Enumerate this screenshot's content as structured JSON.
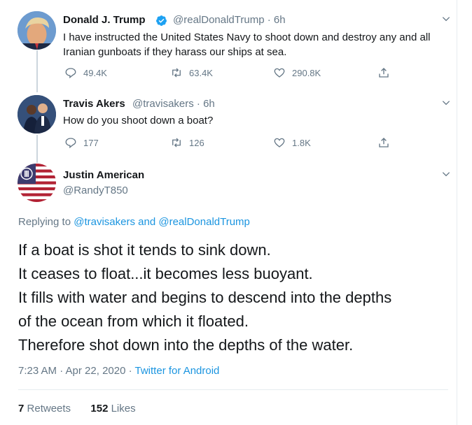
{
  "thread": [
    {
      "author_name": "Donald J. Trump",
      "handle": "@realDonaldTrump",
      "time": "· 6h",
      "text": "I have instructed the United States Navy to shoot down and destroy any and all Iranian gunboats if they harass our ships at sea.",
      "replies": "49.4K",
      "retweets": "63.4K",
      "likes": "290.8K",
      "verified": true
    },
    {
      "author_name": "Travis Akers",
      "handle": "@travisakers",
      "time": "· 6h",
      "text": "How do you shoot down a boat?",
      "replies": "177",
      "retweets": "126",
      "likes": "1.8K"
    }
  ],
  "main_tweet": {
    "author_name": "Justin American",
    "handle": "@RandyT850",
    "replying_prefix": "Replying to",
    "replying_user_1": "@travisakers",
    "replying_and": "and",
    "replying_user_2": "@realDonaldTrump",
    "lines": [
      "If a boat is shot it tends to sink down.",
      "It ceases to float...it becomes less buoyant.",
      "It fills with water and begins to descend into the depths",
      "of the ocean from which it floated.",
      "Therefore shot down into the depths of the water."
    ],
    "time": "7:23 AM · Apr 22, 2020 ·",
    "source": "Twitter for Android",
    "retweets_count": "7",
    "retweets_label": "Retweets",
    "likes_count": "152",
    "likes_label": "Likes"
  },
  "colors": {
    "accent": "#1b95e0",
    "secondary_text": "#657786",
    "primary_text": "#14171a",
    "thread_line": "#ccd6dd"
  },
  "icons": [
    "reply-icon",
    "retweet-icon",
    "like-icon",
    "share-icon",
    "chevron-down-icon",
    "verified-badge-icon"
  ]
}
